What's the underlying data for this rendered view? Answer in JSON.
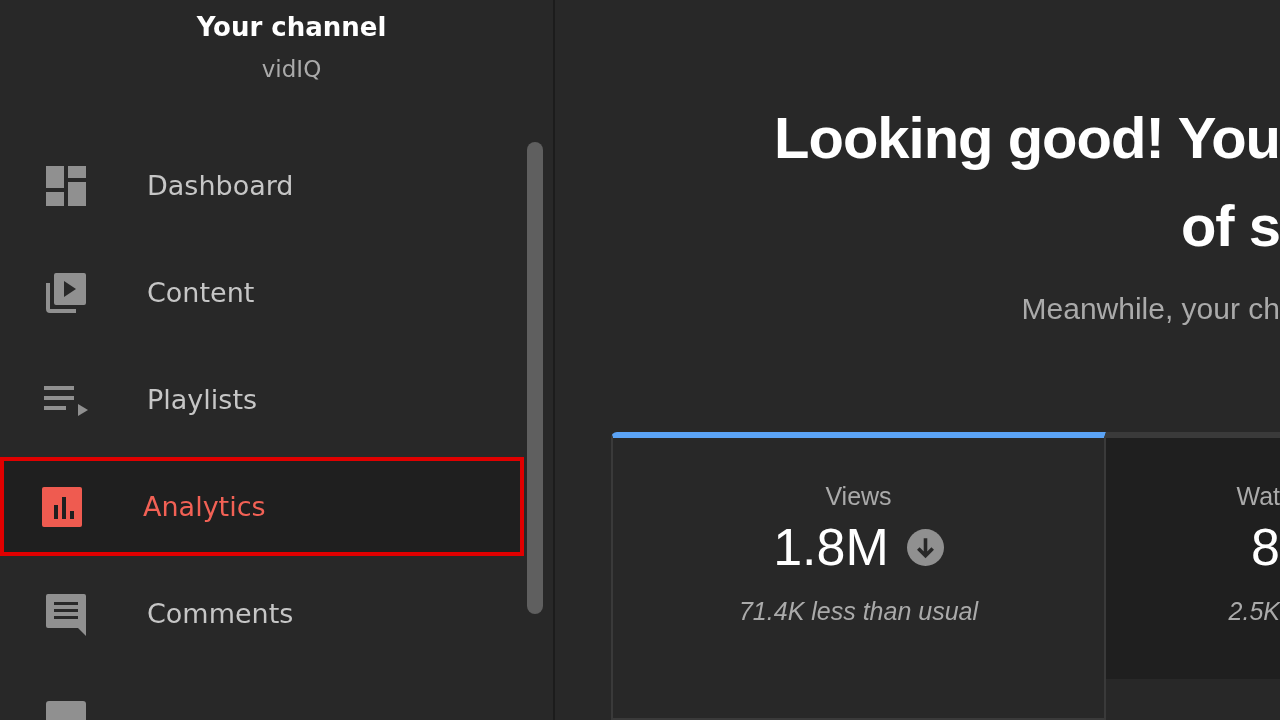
{
  "sidebar": {
    "title": "Your channel",
    "subtitle": "vidIQ",
    "items": [
      {
        "label": "Dashboard",
        "kind": "dashboard",
        "selected": false
      },
      {
        "label": "Content",
        "kind": "content",
        "selected": false
      },
      {
        "label": "Playlists",
        "kind": "playlists",
        "selected": false
      },
      {
        "label": "Analytics",
        "kind": "analytics",
        "selected": true
      },
      {
        "label": "Comments",
        "kind": "comments",
        "selected": false
      },
      {
        "kind": "subtitles",
        "selected": false
      }
    ]
  },
  "main": {
    "headline": [
      "Looking good! You",
      "of s"
    ],
    "subtitle": "Meanwhile, your ch",
    "cards": [
      {
        "label": "Views",
        "value": "1.8M",
        "kind": "decrease",
        "note": "71.4K less than usual",
        "selected": true
      },
      {
        "label": "Wat",
        "value": "8",
        "note": "2.5K",
        "selected": false
      }
    ]
  }
}
